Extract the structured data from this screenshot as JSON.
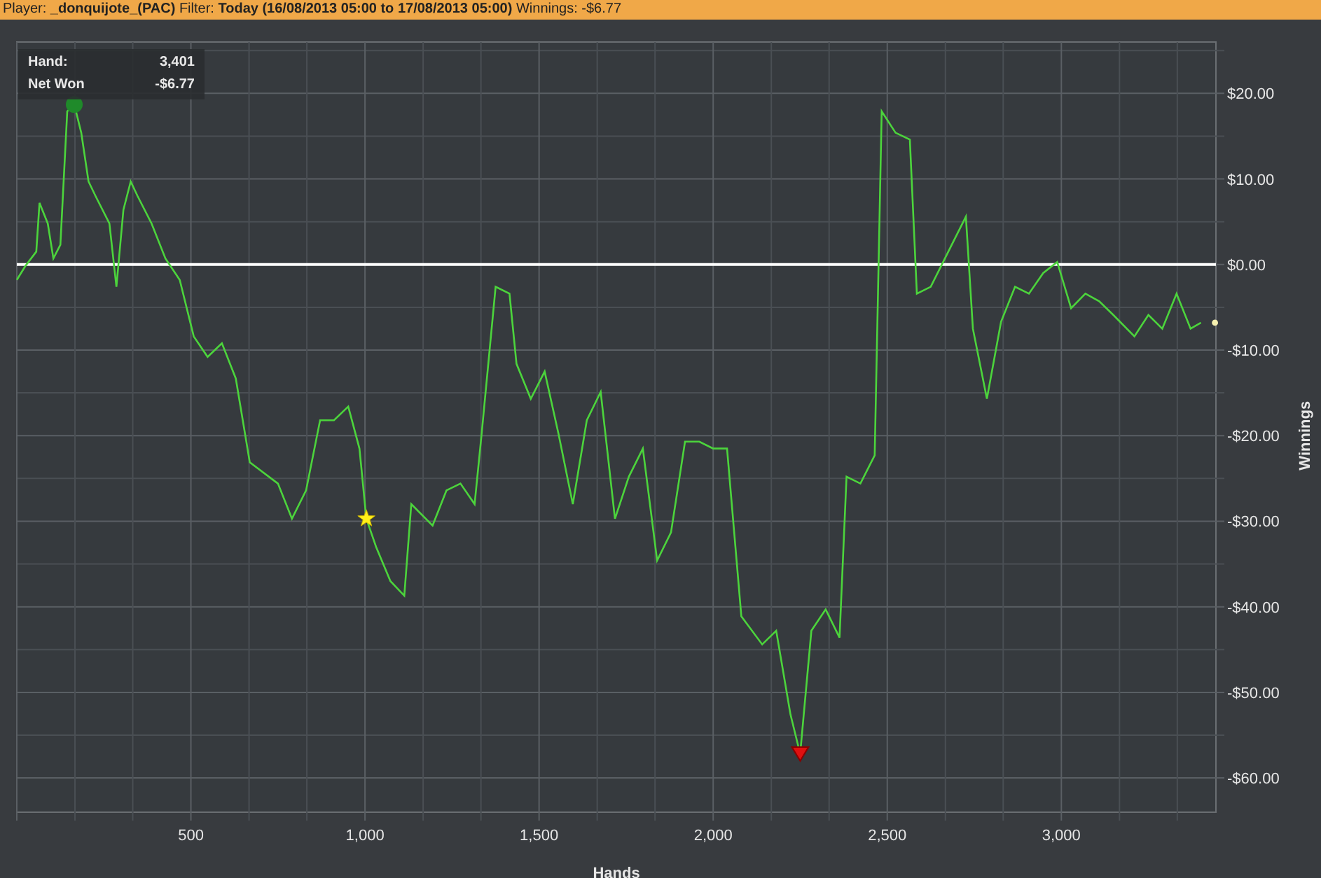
{
  "header": {
    "text": "Player: **_donquijote_(PAC)** Filter: **Today (16/08/2013 05:00 to 17/08/2013 05:00)** Winnings: -$6.77"
  },
  "tooltip": {
    "rows": [
      {
        "label": "Hand:",
        "value": "3,401"
      },
      {
        "label": "Net Won",
        "value": "-$6.77"
      }
    ]
  },
  "chart_data": {
    "type": "line",
    "xlabel": "Hands",
    "ylabel": "Winnings",
    "xlim": [
      0,
      3444
    ],
    "ylim": [
      -64,
      26
    ],
    "xticks": [
      {
        "value": 500,
        "label": "500"
      },
      {
        "value": 1000,
        "label": "1,000"
      },
      {
        "value": 1500,
        "label": "1,500"
      },
      {
        "value": 2000,
        "label": "2,000"
      },
      {
        "value": 2500,
        "label": "2,500"
      },
      {
        "value": 3000,
        "label": "3,000"
      }
    ],
    "yticks": [
      {
        "value": 20,
        "label": "$20.00"
      },
      {
        "value": 10,
        "label": "$10.00"
      },
      {
        "value": 0,
        "label": "$0.00"
      },
      {
        "value": -10,
        "label": "-$10.00"
      },
      {
        "value": -20,
        "label": "-$20.00"
      },
      {
        "value": -30,
        "label": "-$30.00"
      },
      {
        "value": -40,
        "label": "-$40.00"
      },
      {
        "value": -50,
        "label": "-$50.00"
      },
      {
        "value": -60,
        "label": "-$60.00"
      }
    ],
    "x": [
      0,
      24,
      56,
      65,
      89,
      105,
      125,
      145,
      165,
      185,
      206,
      226,
      266,
      286,
      306,
      327,
      347,
      387,
      427,
      468,
      508,
      548,
      589,
      629,
      669,
      750,
      790,
      831,
      871,
      911,
      952,
      984,
      1004,
      1032,
      1073,
      1113,
      1133,
      1194,
      1234,
      1274,
      1315,
      1335,
      1375,
      1415,
      1435,
      1476,
      1516,
      1556,
      1597,
      1637,
      1677,
      1718,
      1758,
      1798,
      1839,
      1879,
      1919,
      1960,
      2000,
      2040,
      2081,
      2141,
      2181,
      2222,
      2250,
      2282,
      2323,
      2363,
      2383,
      2423,
      2464,
      2484,
      2524,
      2565,
      2585,
      2625,
      2685,
      2726,
      2746,
      2786,
      2827,
      2867,
      2907,
      2948,
      2988,
      3028,
      3069,
      3109,
      3149,
      3210,
      3250,
      3290,
      3331,
      3371,
      3401
    ],
    "grid": true,
    "series": [
      {
        "color": "#4cd43c",
        "values": [
          -1.8,
          -0.2,
          1.5,
          7.2,
          4.8,
          0.7,
          2.3,
          17.9,
          18.7,
          15.4,
          9.7,
          8.0,
          4.8,
          -2.6,
          6.4,
          9.7,
          8.0,
          4.8,
          0.7,
          -1.8,
          -8.4,
          -10.8,
          -9.2,
          -13.3,
          -23.1,
          -25.6,
          -29.7,
          -26.4,
          -18.2,
          -18.2,
          -16.6,
          -21.5,
          -29.7,
          -33.0,
          -37.0,
          -38.7,
          -28.0,
          -30.5,
          -26.4,
          -25.6,
          -28.0,
          -19.8,
          -2.6,
          -3.4,
          -11.6,
          -15.7,
          -12.5,
          -19.8,
          -28.0,
          -18.2,
          -14.9,
          -29.7,
          -24.8,
          -21.5,
          -34.6,
          -31.3,
          -20.7,
          -20.7,
          -21.5,
          -21.5,
          -41.1,
          -44.4,
          -42.8,
          -52.6,
          -57.2,
          -42.8,
          -40.3,
          -43.6,
          -24.8,
          -25.6,
          -22.3,
          17.9,
          15.4,
          14.6,
          -3.4,
          -2.6,
          2.3,
          5.6,
          -7.5,
          -15.7,
          -6.7,
          -2.6,
          -3.4,
          -1.0,
          0.3,
          -5.1,
          -3.4,
          -4.3,
          -5.9,
          -8.4,
          -5.9,
          -7.5,
          -3.4,
          -7.5,
          -6.8
        ]
      }
    ]
  },
  "markers": [
    {
      "kind": "max"
    },
    {
      "kind": "star"
    },
    {
      "kind": "min"
    },
    {
      "kind": "last"
    }
  ]
}
